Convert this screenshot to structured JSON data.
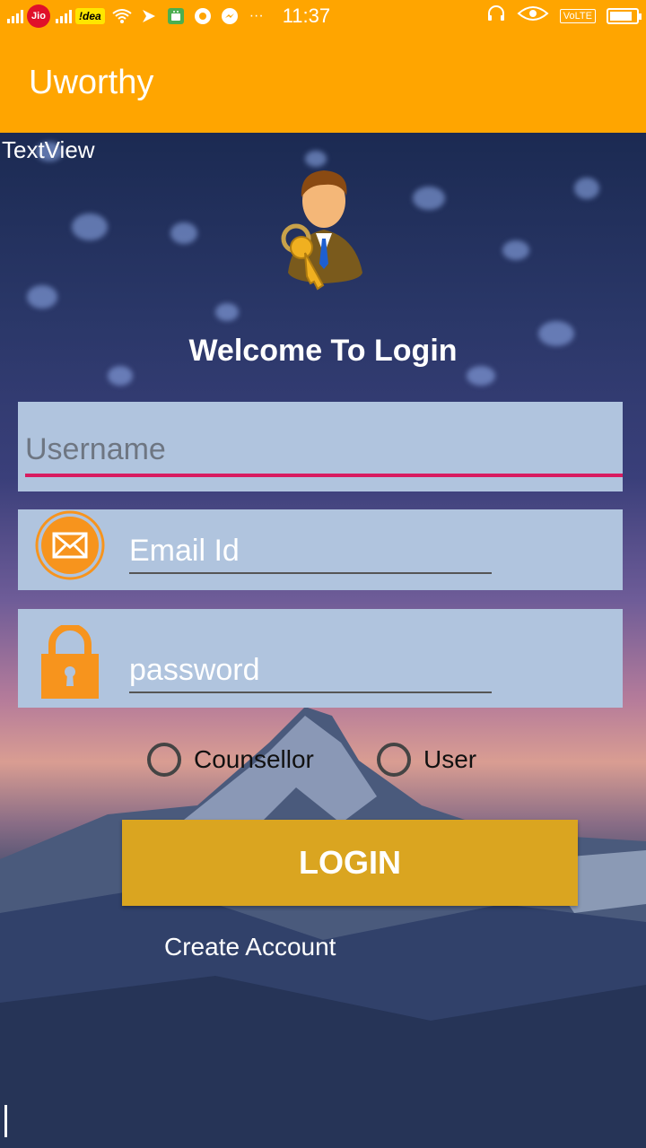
{
  "status_bar": {
    "carrier_1": "Jio",
    "carrier_2": "!dea",
    "time": "11:37",
    "volte": "VoLTE",
    "battery_level": 0.85,
    "icons": [
      "signal-icon",
      "wifi-icon",
      "notification-icon",
      "android-icon",
      "chrome-icon",
      "messenger-icon",
      "more-icon",
      "headset-icon",
      "eye-icon",
      "battery-icon"
    ]
  },
  "app_bar": {
    "title": "Uworthy",
    "color": "#ffa500"
  },
  "textview": "TextView",
  "welcome": "Welcome To Login",
  "form": {
    "username_placeholder": "Username",
    "email_placeholder": "Email Id",
    "password_placeholder": "password",
    "radio_options": [
      "Counsellor",
      "User"
    ],
    "login_label": "LOGIN",
    "create_account_label": "Create Account"
  },
  "colors": {
    "accent": "#d81b60",
    "button": "#daa520",
    "field_bg": "#b0c4de"
  }
}
